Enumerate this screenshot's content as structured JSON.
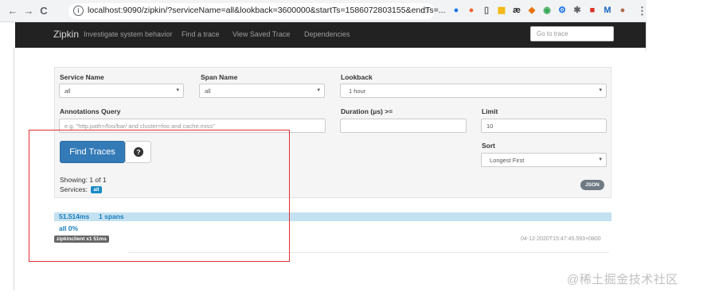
{
  "browser": {
    "back_glyph": "←",
    "forward_glyph": "→",
    "reload_glyph": "C",
    "url": "localhost:9090/zipkin/?serviceName=all&lookback=3600000&startTs=1586072803155&endTs=...",
    "star_glyph": "☆",
    "menu_glyph": "⋮",
    "extensions": [
      {
        "name": "extension-1-icon",
        "color": "#1a73e8",
        "glyph": "●"
      },
      {
        "name": "extension-2-icon",
        "color": "#f0642b",
        "glyph": "●"
      },
      {
        "name": "bookmark-icon",
        "color": "#5f6368",
        "glyph": "▯"
      },
      {
        "name": "extension-grid-icon",
        "color": "#f4b400",
        "glyph": "▦"
      },
      {
        "name": "extension-ae-icon",
        "color": "#202124",
        "glyph": "æ"
      },
      {
        "name": "extension-shield-icon",
        "color": "#e8710a",
        "glyph": "◆"
      },
      {
        "name": "extension-circle-icon",
        "color": "#34a853",
        "glyph": "◉"
      },
      {
        "name": "extension-settings-icon",
        "color": "#1a73e8",
        "glyph": "⚙"
      },
      {
        "name": "extension-star-icon",
        "color": "#5f6368",
        "glyph": "✱"
      },
      {
        "name": "extension-red-icon",
        "color": "#d93025",
        "glyph": "■"
      },
      {
        "name": "extension-m-icon",
        "color": "#1565c0",
        "glyph": "M"
      },
      {
        "name": "profile-avatar-icon",
        "color": "#b06a4a",
        "glyph": "●"
      }
    ]
  },
  "navbar": {
    "brand": "Zipkin",
    "tagline": "Investigate system behavior",
    "links": [
      "Find a trace",
      "View Saved Trace",
      "Dependencies"
    ],
    "goto_placeholder": "Go to trace"
  },
  "search": {
    "service_name_label": "Service Name",
    "service_name_value": "all",
    "span_name_label": "Span Name",
    "span_name_value": "all",
    "lookback_label": "Lookback",
    "lookback_value": "1 hour",
    "annotations_label": "Annotations Query",
    "annotations_placeholder": "e.g. \"http.path=/foo/bar/ and cluster=foo and cache.miss\"",
    "duration_label": "Duration (μs) >=",
    "duration_value": "",
    "limit_label": "Limit",
    "limit_value": "10",
    "sort_label": "Sort",
    "sort_value": "Longest First",
    "find_button": "Find Traces",
    "help_glyph": "?",
    "caret_glyph": "▾"
  },
  "results": {
    "showing": "Showing: 1 of 1",
    "services_label": "Services:",
    "services_badge": "all",
    "json_button": "JSON",
    "trace": {
      "duration": "51.514ms",
      "spans": "1 spans",
      "service_pct": "all 0%",
      "service_badge": "zipkinclient x1 51ms",
      "timestamp": "04-12-2020T15:47:45.593+0800"
    }
  },
  "watermark": "@稀土掘金技术社区",
  "colors": {
    "accent": "#337ab7",
    "navbar": "#222222",
    "annotation": "#e03030",
    "result_bar": "#c3e1f0"
  }
}
